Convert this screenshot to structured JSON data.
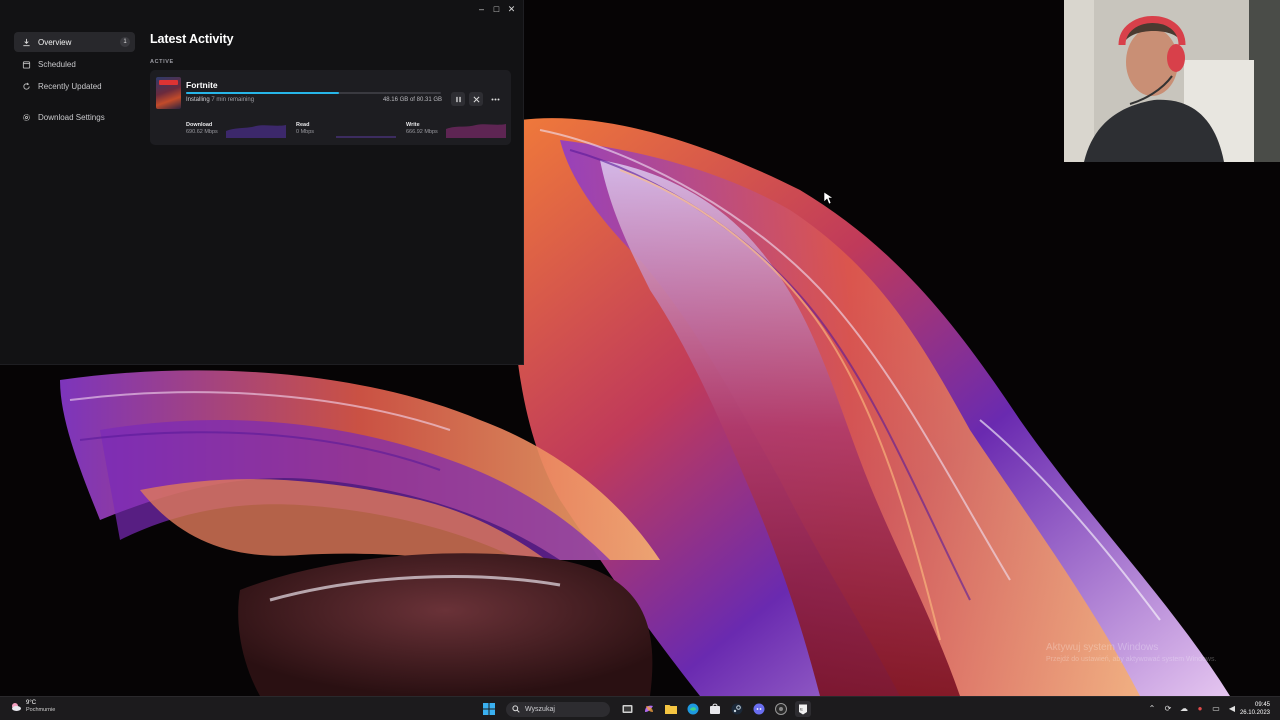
{
  "window": {
    "controls": {
      "minimize": "–",
      "maximize": "□",
      "close": "✕"
    }
  },
  "sidebar": {
    "items": [
      {
        "label": "Overview",
        "icon": "download-icon",
        "badge": "1",
        "active": true
      },
      {
        "label": "Scheduled",
        "icon": "calendar-icon"
      },
      {
        "label": "Recently Updated",
        "icon": "refresh-icon"
      },
      {
        "label": "Download Settings",
        "icon": "gear-icon"
      }
    ]
  },
  "main": {
    "title": "Latest Activity",
    "section_label": "ACTIVE",
    "download": {
      "game": "Fortnite",
      "status": "Installing",
      "remaining": "7 min remaining",
      "size": "48.16 GB of 80.31 GB",
      "progress": 0.6,
      "metrics": [
        {
          "label": "Download",
          "value": "690.62 Mbps"
        },
        {
          "label": "Read",
          "value": "0 Mbps"
        },
        {
          "label": "Write",
          "value": "666.92 Mbps"
        }
      ]
    }
  },
  "watermark": {
    "line1": "Aktywuj system Windows",
    "line2": "Przejdź do ustawień, aby aktywować system Windows."
  },
  "taskbar": {
    "weather": {
      "temp": "9°C",
      "condition": "Pochmurnie"
    },
    "search_placeholder": "Wyszukaj",
    "clock": {
      "time": "09:45",
      "date": "26.10.2023"
    }
  },
  "colors": {
    "accent": "#27b6e8",
    "window_bg": "#121214",
    "card_bg": "#1d1d21"
  }
}
